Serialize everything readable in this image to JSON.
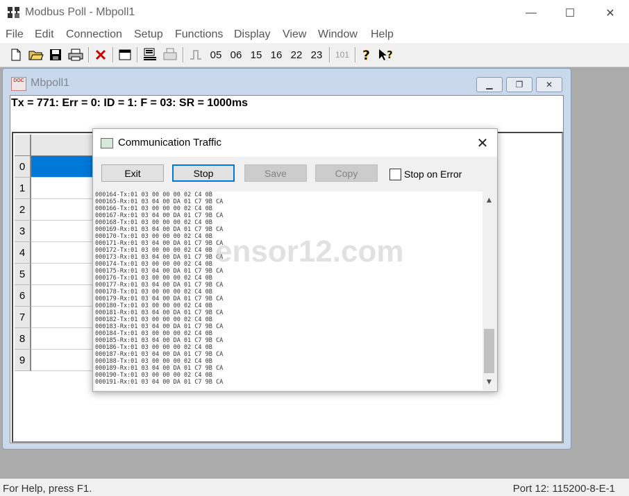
{
  "app": {
    "title": "Modbus Poll - Mbpoll1"
  },
  "window_controls": {
    "minimize": "—",
    "maximize": "☐",
    "close": "✕"
  },
  "menu": [
    "File",
    "Edit",
    "Connection",
    "Setup",
    "Functions",
    "Display",
    "View",
    "Window",
    "Help"
  ],
  "toolbar": {
    "fc_buttons": [
      "05",
      "06",
      "15",
      "16",
      "22",
      "23"
    ],
    "disabled_button": "101"
  },
  "child_window": {
    "title": "Mbpoll1",
    "icon_text": "DOC",
    "status_line": "Tx = 771: Err = 0: ID = 1: F = 03: SR = 1000ms",
    "rows": [
      "0",
      "1",
      "2",
      "3",
      "4",
      "5",
      "6",
      "7",
      "8",
      "9"
    ],
    "selected_row": "0"
  },
  "dialog": {
    "title": "Communication Traffic",
    "buttons": {
      "exit": "Exit",
      "stop": "Stop",
      "save": "Save",
      "copy": "Copy"
    },
    "stop_on_error_label": "Stop on Error",
    "stop_on_error_checked": false,
    "log_lines": [
      "000164-Tx:01 03 00 00 00 02 C4 0B",
      "000165-Rx:01 03 04 00 DA 01 C7 9B CA",
      "000166-Tx:01 03 00 00 00 02 C4 0B",
      "000167-Rx:01 03 04 00 DA 01 C7 9B CA",
      "000168-Tx:01 03 00 00 00 02 C4 0B",
      "000169-Rx:01 03 04 00 DA 01 C7 9B CA",
      "000170-Tx:01 03 00 00 00 02 C4 0B",
      "000171-Rx:01 03 04 00 DA 01 C7 9B CA",
      "000172-Tx:01 03 00 00 00 02 C4 0B",
      "000173-Rx:01 03 04 00 DA 01 C7 9B CA",
      "000174-Tx:01 03 00 00 00 02 C4 0B",
      "000175-Rx:01 03 04 00 DA 01 C7 9B CA",
      "000176-Tx:01 03 00 00 00 02 C4 0B",
      "000177-Rx:01 03 04 00 DA 01 C7 9B CA",
      "000178-Tx:01 03 00 00 00 02 C4 0B",
      "000179-Rx:01 03 04 00 DA 01 C7 9B CA",
      "000180-Tx:01 03 00 00 00 02 C4 0B",
      "000181-Rx:01 03 04 00 DA 01 C7 9B CA",
      "000182-Tx:01 03 00 00 00 02 C4 0B",
      "000183-Rx:01 03 04 00 DA 01 C7 9B CA",
      "000184-Tx:01 03 00 00 00 02 C4 0B",
      "000185-Rx:01 03 04 00 DA 01 C7 9B CA",
      "000186-Tx:01 03 00 00 00 02 C4 0B",
      "000187-Rx:01 03 04 00 DA 01 C7 9B CA",
      "000188-Tx:01 03 00 00 00 02 C4 0B",
      "000189-Rx:01 03 04 00 DA 01 C7 9B CA",
      "000190-Tx:01 03 00 00 00 02 C4 0B",
      "000191-Rx:01 03 04 00 DA 01 C7 9B CA"
    ]
  },
  "watermark": "ensor12.com",
  "status_bar": {
    "help_text": "For Help, press F1.",
    "port_text": "Port 12: 115200-8-E-1"
  },
  "colors": {
    "selection": "#0078d7",
    "mdi_background": "#ababab"
  }
}
